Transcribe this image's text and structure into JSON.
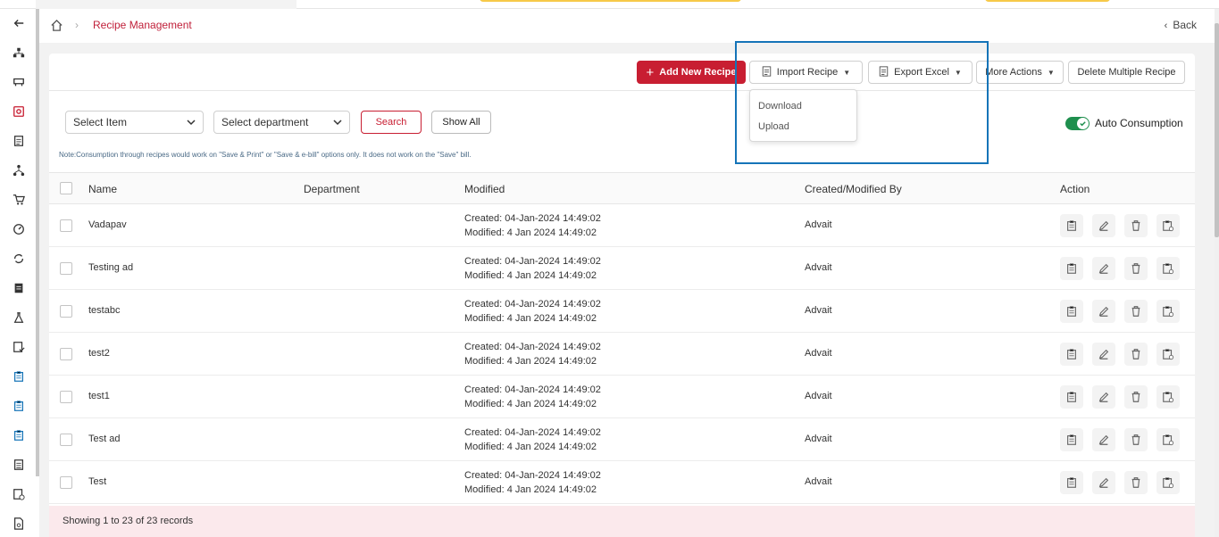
{
  "breadcrumb": {
    "page": "Recipe Management",
    "back_label": "Back"
  },
  "toolbar": {
    "add_label": "Add New Recipe",
    "import_label": "Import Recipe",
    "export_label": "Export Excel",
    "more_label": "More Actions",
    "delete_multiple_label": "Delete Multiple Recipe"
  },
  "import_menu": {
    "items": [
      "Download",
      "Upload"
    ]
  },
  "filters": {
    "item_placeholder": "Select Item",
    "department_placeholder": "Select department",
    "search_label": "Search",
    "show_all_label": "Show All",
    "auto_consumption_label": "Auto Consumption",
    "auto_consumption_on": true,
    "note": "Note:Consumption through recipes would work on \"Save & Print\" or \"Save & e-bill\" options only. It does not work on the \"Save\" bill."
  },
  "table": {
    "columns": [
      "Name",
      "Department",
      "Modified",
      "Created/Modified By",
      "Action"
    ],
    "rows": [
      {
        "name": "Vadapav",
        "department": "",
        "created": "Created: 04-Jan-2024 14:49:02",
        "modified": "Modified: 4 Jan 2024 14:49:02",
        "by": "Advait"
      },
      {
        "name": "Testing ad",
        "department": "",
        "created": "Created: 04-Jan-2024 14:49:02",
        "modified": "Modified: 4 Jan 2024 14:49:02",
        "by": "Advait"
      },
      {
        "name": "testabc",
        "department": "",
        "created": "Created: 04-Jan-2024 14:49:02",
        "modified": "Modified: 4 Jan 2024 14:49:02",
        "by": "Advait"
      },
      {
        "name": "test2",
        "department": "",
        "created": "Created: 04-Jan-2024 14:49:02",
        "modified": "Modified: 4 Jan 2024 14:49:02",
        "by": "Advait"
      },
      {
        "name": "test1",
        "department": "",
        "created": "Created: 04-Jan-2024 14:49:02",
        "modified": "Modified: 4 Jan 2024 14:49:02",
        "by": "Advait"
      },
      {
        "name": "Test ad",
        "department": "",
        "created": "Created: 04-Jan-2024 14:49:02",
        "modified": "Modified: 4 Jan 2024 14:49:02",
        "by": "Advait"
      },
      {
        "name": "Test",
        "department": "",
        "created": "Created: 04-Jan-2024 14:49:02",
        "modified": "Modified: 4 Jan 2024 14:49:02",
        "by": "Advait"
      }
    ]
  },
  "footer": {
    "records": "Showing 1 to 23 of 23 records"
  },
  "colors": {
    "brand": "#c81e32",
    "toggle": "#1f8f4e",
    "highlight": "#1574b8"
  }
}
